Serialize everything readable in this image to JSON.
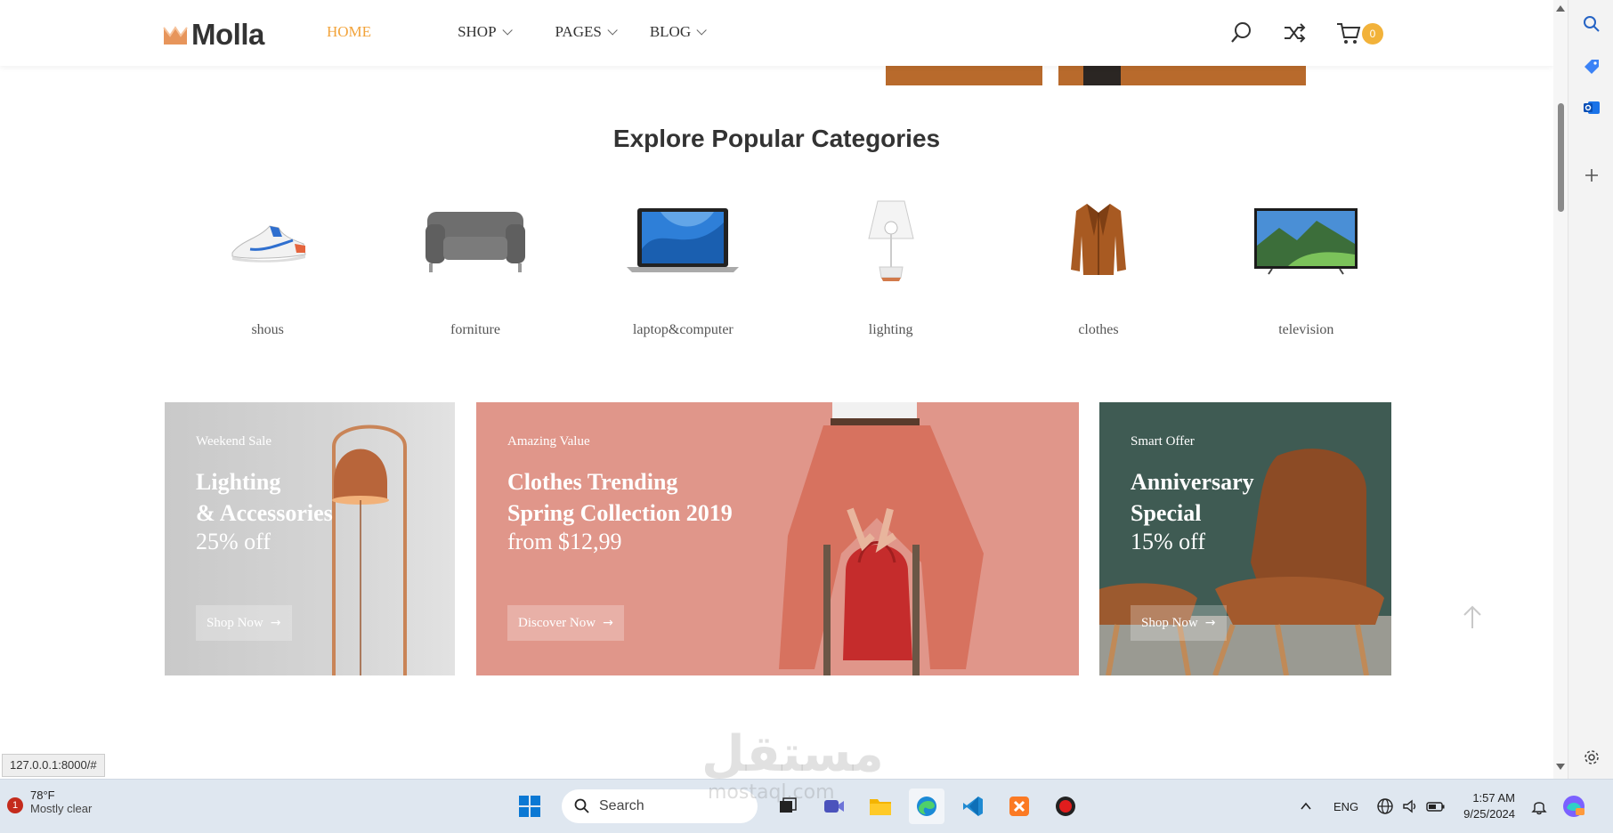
{
  "header": {
    "logo_text": "Molla",
    "nav": [
      {
        "label": "HOME"
      },
      {
        "label": "SHOP"
      },
      {
        "label": "PAGES"
      },
      {
        "label": "BLOG"
      }
    ],
    "cart_count": "0",
    "accent_color": "#f2a33a"
  },
  "categories": {
    "title": "Explore Popular Categories",
    "items": [
      {
        "label": "shous",
        "icon": "sneaker-image"
      },
      {
        "label": "forniture",
        "icon": "armchair-image"
      },
      {
        "label": "laptop&computer",
        "icon": "laptop-image"
      },
      {
        "label": "lighting",
        "icon": "lamp-image"
      },
      {
        "label": "clothes",
        "icon": "jacket-image"
      },
      {
        "label": "television",
        "icon": "tv-image"
      }
    ]
  },
  "banners": [
    {
      "subtitle": "Weekend Sale",
      "title": "Lighting\n& Accessories",
      "offer": "25% off",
      "button": "Shop Now"
    },
    {
      "subtitle": "Amazing Value",
      "title": "Clothes Trending\nSpring Collection 2019",
      "offer": "from $12,99",
      "button": "Discover Now"
    },
    {
      "subtitle": "Smart Offer",
      "title": "Anniversary\nSpecial",
      "offer": "15% off",
      "button": "Shop Now"
    }
  ],
  "status_url": "127.0.0.1:8000/#",
  "taskbar": {
    "weather_temp": "78°F",
    "weather_condition": "Mostly clear",
    "weather_badge": "1",
    "search_placeholder": "Search",
    "language": "ENG",
    "time": "1:57 AM",
    "date": "9/25/2024"
  },
  "watermark": {
    "arabic": "مستقل",
    "latin": "mostaql.com"
  }
}
